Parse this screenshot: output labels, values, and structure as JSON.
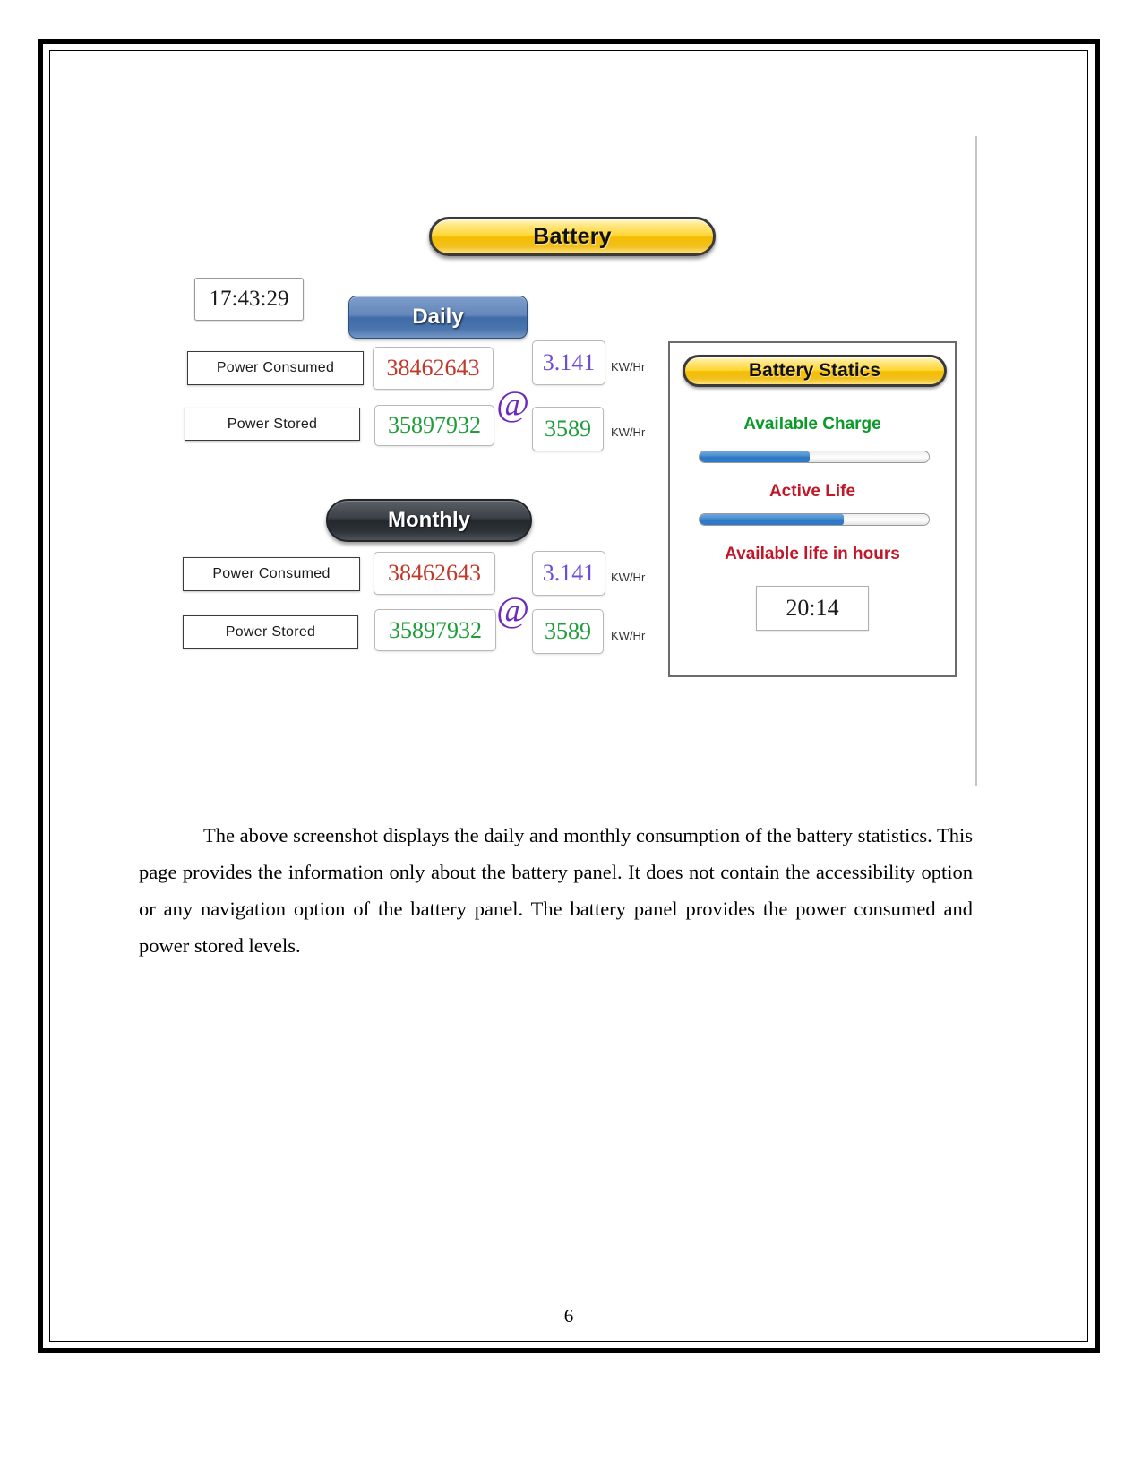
{
  "document": {
    "page_number": "6",
    "paragraph": "The above screenshot displays the daily and monthly consumption of the battery statistics. This page provides the information only about the battery panel. It does not contain the accessibility option or any navigation option of the battery panel. The battery panel provides the power consumed and power stored levels."
  },
  "screenshot": {
    "title": "Battery",
    "clock": "17:43:29",
    "at_symbol": "@",
    "sections": [
      {
        "tab_label": "Daily",
        "rows": [
          {
            "label": "Power Consumed",
            "raw_value": "38462643",
            "raw_color": "#c0392b",
            "rate_value": "3.141",
            "rate_color": "#6c4bd8",
            "unit": "KW/Hr"
          },
          {
            "label": "Power Stored",
            "raw_value": "35897932",
            "raw_color": "#1f9d3a",
            "rate_value": "3589",
            "rate_color": "#1f9d3a",
            "unit": "KW/Hr"
          }
        ]
      },
      {
        "tab_label": "Monthly",
        "rows": [
          {
            "label": "Power Consumed",
            "raw_value": "38462643",
            "raw_color": "#c0392b",
            "rate_value": "3.141",
            "rate_color": "#6c4bd8",
            "unit": "KW/Hr"
          },
          {
            "label": "Power Stored",
            "raw_value": "35897932",
            "raw_color": "#1f9d3a",
            "rate_value": "3589",
            "rate_color": "#1f9d3a",
            "unit": "KW/Hr"
          }
        ]
      }
    ],
    "statics_panel": {
      "title": "Battery Statics",
      "available_charge_label": "Available Charge",
      "available_charge_percent": 48,
      "active_life_label": "Active Life",
      "active_life_percent": 63,
      "available_life_label": "Available life in hours",
      "available_life_value": "20:14"
    },
    "colors": {
      "title_button_accent": "#ffd633",
      "daily_button": "#3f6ba7",
      "monthly_button": "#23282d",
      "progress_fill": "#2f78c4",
      "heading_green": "#0a9a28",
      "heading_red": "#c0182a"
    }
  }
}
